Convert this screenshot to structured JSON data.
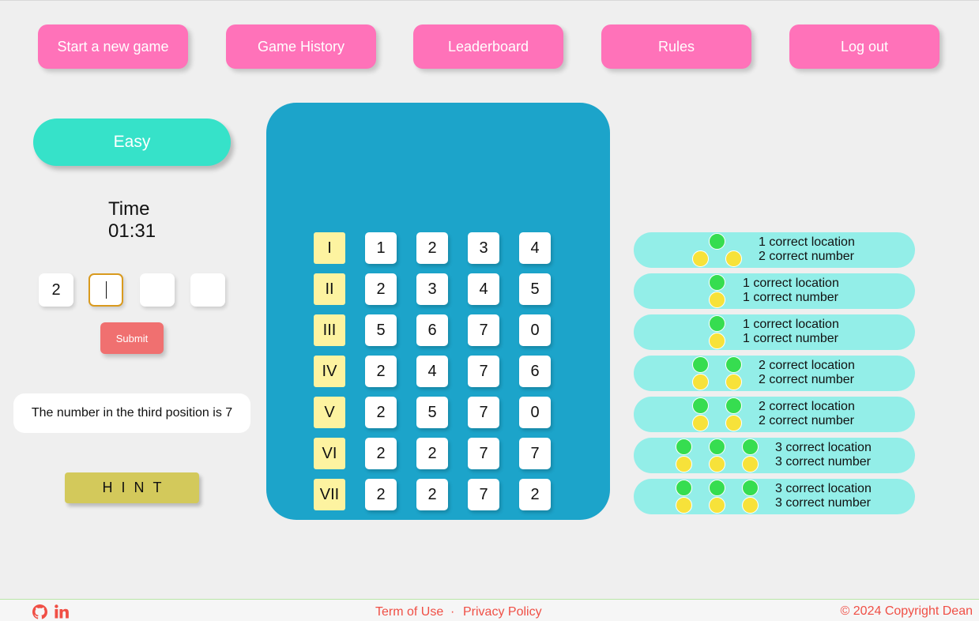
{
  "nav": {
    "start_new_game": "Start a new game",
    "game_history": "Game History",
    "leaderboard": "Leaderboard",
    "rules": "Rules",
    "log_out": "Log out"
  },
  "difficulty": "Easy",
  "timer": {
    "label": "Time",
    "value": "01:31"
  },
  "guess": {
    "digits": [
      "2",
      "",
      "",
      ""
    ],
    "active_index": 1
  },
  "submit_label": "Submit",
  "hint_message": "The number in the third position is 7",
  "hint_label": "HINT",
  "board": {
    "rows": [
      {
        "label": "I",
        "digits": [
          "1",
          "2",
          "3",
          "4"
        ]
      },
      {
        "label": "II",
        "digits": [
          "2",
          "3",
          "4",
          "5"
        ]
      },
      {
        "label": "III",
        "digits": [
          "5",
          "6",
          "7",
          "0"
        ]
      },
      {
        "label": "IV",
        "digits": [
          "2",
          "4",
          "7",
          "6"
        ]
      },
      {
        "label": "V",
        "digits": [
          "2",
          "5",
          "7",
          "0"
        ]
      },
      {
        "label": "VI",
        "digits": [
          "2",
          "2",
          "7",
          "7"
        ]
      },
      {
        "label": "VII",
        "digits": [
          "2",
          "2",
          "7",
          "2"
        ]
      }
    ]
  },
  "feedback": [
    {
      "correct_location": 1,
      "correct_number": 2,
      "location_text": "1 correct location",
      "number_text": "2 correct number"
    },
    {
      "correct_location": 1,
      "correct_number": 1,
      "location_text": "1 correct location",
      "number_text": "1 correct number"
    },
    {
      "correct_location": 1,
      "correct_number": 1,
      "location_text": "1 correct location",
      "number_text": "1 correct number"
    },
    {
      "correct_location": 2,
      "correct_number": 2,
      "location_text": "2 correct location",
      "number_text": "2 correct number"
    },
    {
      "correct_location": 2,
      "correct_number": 2,
      "location_text": "2 correct location",
      "number_text": "2 correct number"
    },
    {
      "correct_location": 3,
      "correct_number": 3,
      "location_text": "3 correct location",
      "number_text": "3 correct number"
    },
    {
      "correct_location": 3,
      "correct_number": 3,
      "location_text": "3 correct location",
      "number_text": "3 correct number"
    }
  ],
  "footer": {
    "icons": [
      "github-icon",
      "linkedin-icon"
    ],
    "term_of_use": "Term of Use",
    "separator": "·",
    "privacy_policy": "Privacy Policy",
    "copyright": "© 2024 Copyright Dean"
  },
  "colors": {
    "nav_button": "#ff72b9",
    "difficulty": "#36e2c9",
    "board": "#1ca4ca",
    "row_label": "#fdf3a0",
    "feedback_bg": "#93eee8",
    "location_dot": "#36dd50",
    "number_dot": "#f7e23a",
    "submit": "#f07070",
    "hint": "#d3c95b",
    "footer_text": "#f04f45"
  }
}
